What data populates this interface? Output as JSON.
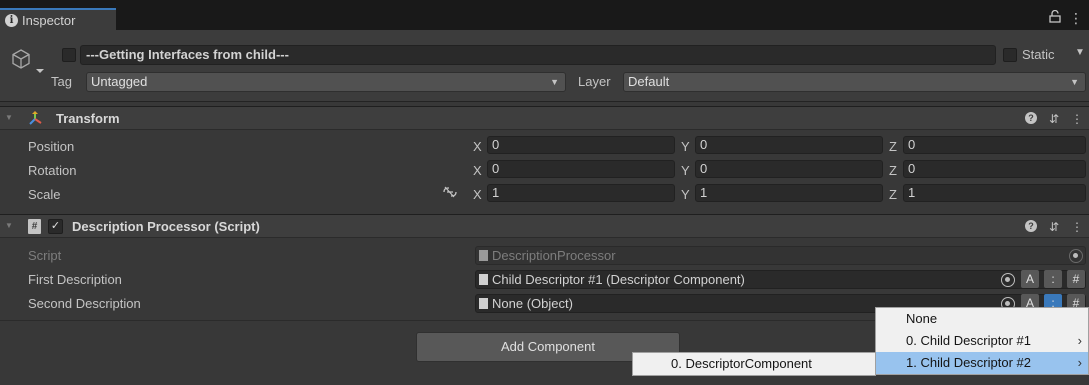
{
  "window": {
    "tab_label": "Inspector",
    "lock_icon": "lock-icon",
    "menu_icon": "kebab-menu-icon"
  },
  "game_object": {
    "name": "---Getting Interfaces from child---",
    "static_label": "Static",
    "tag_label": "Tag",
    "tag_value": "Untagged",
    "layer_label": "Layer",
    "layer_value": "Default"
  },
  "transform": {
    "title": "Transform",
    "rows": [
      {
        "label": "Position",
        "x": "0",
        "y": "0",
        "z": "0"
      },
      {
        "label": "Rotation",
        "x": "0",
        "y": "0",
        "z": "0"
      },
      {
        "label": "Scale",
        "x": "1",
        "y": "1",
        "z": "1"
      }
    ],
    "axis_x": "X",
    "axis_y": "Y",
    "axis_z": "Z"
  },
  "script_component": {
    "title": "Description Processor (Script)",
    "script_label": "Script",
    "script_value": "DescriptionProcessor",
    "first_label": "First Description",
    "first_value": "Child Descriptor #1 (Descriptor Component)",
    "second_label": "Second Description",
    "second_value": "None (Object)",
    "btn_a": "A",
    "btn_colon": ":",
    "btn_hash": "#"
  },
  "add_component_label": "Add Component",
  "context_menu": {
    "items": [
      "None",
      "0. Child Descriptor #1",
      "1. Child Descriptor #2"
    ],
    "selected_index": 2
  },
  "submenu": {
    "items": [
      "0. DescriptorComponent"
    ]
  },
  "colors": {
    "accent": "#3a79bb",
    "menu_selected": "#98c3ee"
  }
}
